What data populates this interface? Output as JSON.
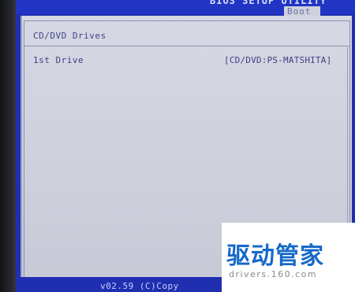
{
  "header": {
    "title": "BIOS SETUP UTILITY",
    "active_tab": "Boot"
  },
  "section": {
    "title": "CD/DVD Drives"
  },
  "items": [
    {
      "label": "1st Drive",
      "value": "[CD/DVD:PS-MATSHITA]"
    }
  ],
  "footer": {
    "version": "v02.59 (C)Copy"
  },
  "watermark": {
    "brand_cn": "驱动管家",
    "brand_url": "drivers.160.com"
  },
  "colors": {
    "bios_blue": "#1f2fb0",
    "panel_gray": "#d0d1dd",
    "text_navy": "#3d3f86",
    "watermark_blue": "#1669c9"
  }
}
